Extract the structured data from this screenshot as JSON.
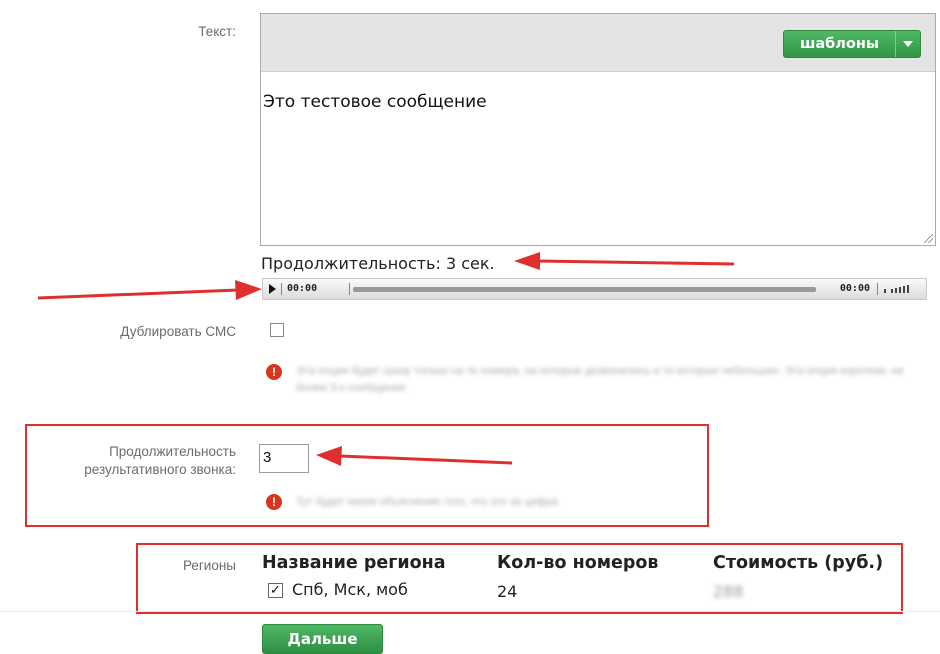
{
  "form": {
    "text_label": "Текст:",
    "templates_button": "шаблоны",
    "message_text": "Это тестовое сообщение",
    "duration_text": "Продолжительность: 3 сек.",
    "player": {
      "current_time": "00:00",
      "total_time": "00:00"
    },
    "duplicate_sms_label": "Дублировать СМС",
    "duplicate_sms_hint": "Эта опция будет сразу только на те номера, на которые дозвонились и те которые небольших. Эта опция короткая, не более 3-х сообщения",
    "result_call_label_line1": "Продолжительность",
    "result_call_label_line2": "результативного звонка:",
    "result_call_value": "3",
    "result_call_hint": "Тут будет некое объяснение того, что это за цифра",
    "regions_label": "Регионы",
    "regions_table": {
      "headers": [
        "Название региона",
        "Кол-во номеров",
        "Стоимость (руб.)"
      ],
      "rows": [
        {
          "name": "Спб, Мск, моб",
          "count": "24",
          "cost": "288"
        }
      ]
    },
    "next_button": "Дальше"
  },
  "colors": {
    "accent_green": "#3aa655",
    "annotation_red": "#e0302e"
  }
}
